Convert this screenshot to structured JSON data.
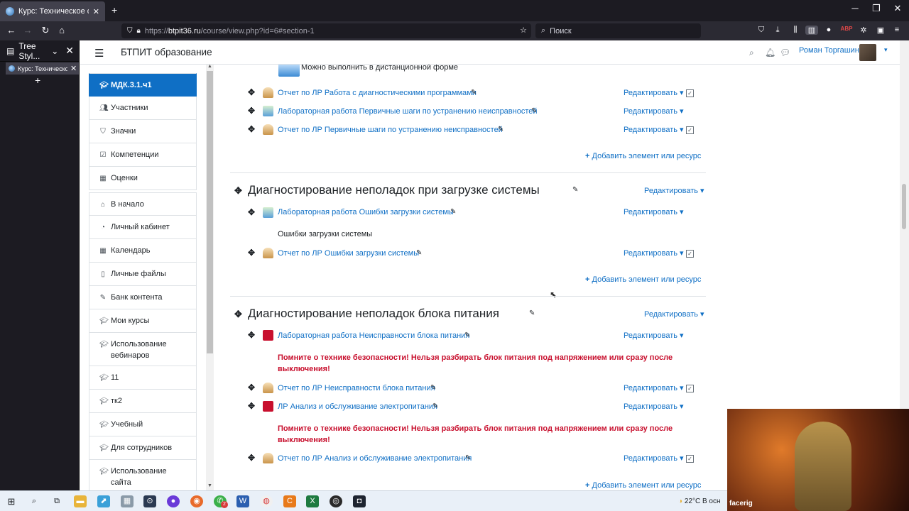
{
  "browser": {
    "tab_title": "Курс: Техническое обслужива",
    "url_host": "btpit36.ru",
    "url_path": "/course/view.php?id=6#section-1",
    "url_scheme": "https://",
    "search_placeholder": "Поиск",
    "window_controls": [
      "minimize-icon",
      "restore-icon",
      "close-icon"
    ]
  },
  "sidebar_tst": {
    "title": "Tree Styl...",
    "tab_title": "Курс: Техническо"
  },
  "header": {
    "site_name": "БТПИТ образование",
    "user_name": "Роман Торгашин"
  },
  "drawer": {
    "items": [
      {
        "label": "МДК.3.1.ч1",
        "icon": "graduation-cap-icon",
        "active": true
      },
      {
        "label": "Участники",
        "icon": "users-icon"
      },
      {
        "label": "Значки",
        "icon": "shield-icon"
      },
      {
        "label": "Компетенции",
        "icon": "check-square-icon"
      },
      {
        "label": "Оценки",
        "icon": "table-icon"
      },
      {
        "label": "В начало",
        "icon": "home-icon"
      },
      {
        "label": "Личный кабинет",
        "icon": "dashboard-icon"
      },
      {
        "label": "Календарь",
        "icon": "calendar-icon"
      },
      {
        "label": "Личные файлы",
        "icon": "file-icon"
      },
      {
        "label": "Банк контента",
        "icon": "brush-icon"
      },
      {
        "label": "Мои курсы",
        "icon": "graduation-cap-icon"
      },
      {
        "label": "Использование вебинаров",
        "icon": "graduation-cap-icon"
      },
      {
        "label": "11",
        "icon": "graduation-cap-icon"
      },
      {
        "label": "тк2",
        "icon": "graduation-cap-icon"
      },
      {
        "label": "Учебный",
        "icon": "graduation-cap-icon"
      },
      {
        "label": "Для сотрудников",
        "icon": "graduation-cap-icon"
      },
      {
        "label": "Использование сайта",
        "icon": "graduation-cap-icon"
      }
    ]
  },
  "main": {
    "remote_note": "Можно выполнить в дистанционной форме",
    "edit_label": "Редактировать",
    "add_label": "Добавить элемент или ресурс",
    "section1": {
      "activities": [
        {
          "label": "Отчет по ЛР Работа с диагностическими программами",
          "type": "assign",
          "checkbox": true
        },
        {
          "label": "Лабораторная работа Первичные шаги по устранению неисправностей",
          "type": "lab",
          "checkbox": false
        },
        {
          "label": "Отчет по ЛР Первичные шаги по устранению неисправностей",
          "type": "assign",
          "checkbox": true
        }
      ]
    },
    "section2": {
      "title": "Диагностирование неполадок при загрузке системы",
      "lab": "Лабораторная работа Ошибки загрузки системы",
      "label_text": "Ошибки загрузки системы",
      "report": "Отчет по ЛР Ошибки загрузки системы"
    },
    "section3": {
      "title": "Диагностирование неполадок блока питания",
      "lab1": "Лабораторная работа Неисправности блока питания",
      "warning": "Помните о технике безопасности! Нельзя разбирать блок питания под напряжением или сразу после выключения!",
      "report1": "Отчет по ЛР Неисправности блока питания",
      "lab2": "ЛР Анализ и обслуживание электропитания",
      "report2": "Отчет по ЛР Анализ и обслуживание электропитания"
    }
  },
  "taskbar": {
    "weather": "22°C  В осн",
    "notification_count": "2"
  },
  "webcam": {
    "label": "facerig"
  },
  "colors": {
    "accent": "#0f6fc5",
    "warning": "#c8102e",
    "browser_dark": "#2b2a33"
  }
}
